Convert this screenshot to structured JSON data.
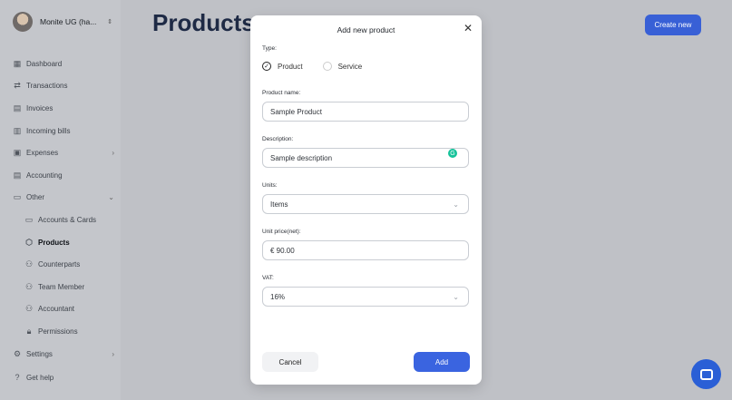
{
  "sidebar": {
    "account_name": "Monite UG (ha...",
    "items": [
      {
        "label": "Dashboard",
        "icon": "grid-icon"
      },
      {
        "label": "Transactions",
        "icon": "transfer-icon"
      },
      {
        "label": "Invoices",
        "icon": "invoice-icon"
      },
      {
        "label": "Incoming bills",
        "icon": "bill-icon"
      },
      {
        "label": "Expenses",
        "icon": "expenses-icon"
      },
      {
        "label": "Accounting",
        "icon": "accounting-icon"
      },
      {
        "label": "Other",
        "icon": "archive-icon"
      },
      {
        "label": "Accounts & Cards",
        "icon": "card-icon"
      },
      {
        "label": "Products",
        "icon": "box-icon"
      },
      {
        "label": "Counterparts",
        "icon": "people-icon"
      },
      {
        "label": "Team Member",
        "icon": "people-icon"
      },
      {
        "label": "Accountant",
        "icon": "people-icon"
      },
      {
        "label": "Permissions",
        "icon": "lock-icon"
      },
      {
        "label": "Settings",
        "icon": "gear-icon"
      }
    ],
    "help_label": "Get help"
  },
  "header": {
    "title": "Products",
    "create_label": "Create new"
  },
  "modal": {
    "title": "Add new product",
    "type_label": "Type:",
    "type_options": [
      "Product",
      "Service"
    ],
    "type_selected": "Product",
    "name_label": "Product name:",
    "name_value": "Sample Product",
    "description_label": "Description:",
    "description_value": "Sample description",
    "units_label": "Units:",
    "units_value": "Items",
    "price_label": "Unit price(net):",
    "price_value": "€ 90.00",
    "vat_label": "VAT:",
    "vat_value": "16%",
    "cancel_label": "Cancel",
    "add_label": "Add"
  },
  "colors": {
    "accent": "#3a64e0",
    "title": "#1e2a45"
  }
}
